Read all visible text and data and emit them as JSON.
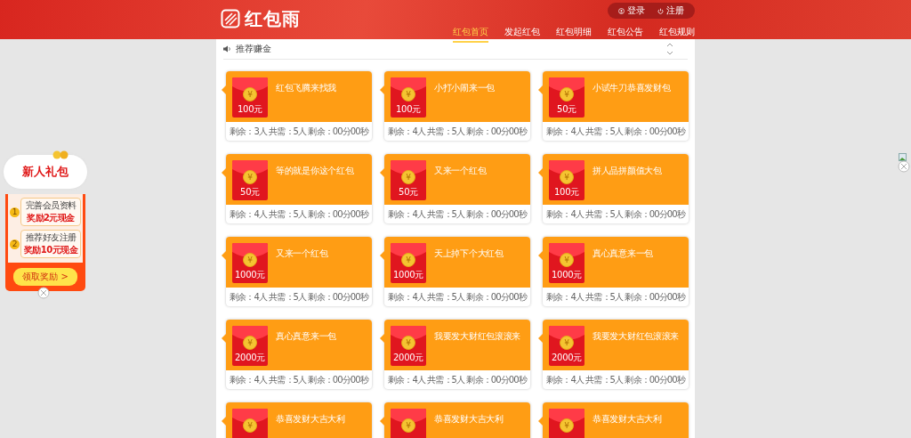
{
  "header": {
    "logo": "红包雨",
    "account_links": [
      {
        "label": "登录",
        "kind": "login"
      },
      {
        "label": "注册",
        "kind": "power"
      }
    ],
    "nav": [
      {
        "label": "红包首页",
        "selected": true
      },
      {
        "label": "发起红包",
        "selected": false
      },
      {
        "label": "红包明细",
        "selected": false
      },
      {
        "label": "红包公告",
        "selected": false
      },
      {
        "label": "红包规则",
        "selected": false
      }
    ]
  },
  "notice": {
    "text": "推荐赚金"
  },
  "cards": [
    {
      "title": "红包飞腾来找我",
      "coin": "¥",
      "amount": "100元",
      "status": "剩余：3人  共需：5人  剩余：00分00秒"
    },
    {
      "title": "小打小闹来一包",
      "coin": "¥",
      "amount": "100元",
      "status": "剩余：4人  共需：5人  剩余：00分00秒"
    },
    {
      "title": "小试牛刀恭喜发财包",
      "coin": "¥",
      "amount": "50元",
      "status": "剩余：4人  共需：5人  剩余：00分00秒"
    },
    {
      "title": "等的就是你这个红包",
      "coin": "¥",
      "amount": "50元",
      "status": "剩余：4人  共需：5人  剩余：00分00秒"
    },
    {
      "title": "又来一个红包",
      "coin": "¥",
      "amount": "50元",
      "status": "剩余：4人  共需：5人  剩余：00分00秒"
    },
    {
      "title": "拼人品拼颜值大包",
      "coin": "¥",
      "amount": "100元",
      "status": "剩余：4人  共需：5人  剩余：00分00秒"
    },
    {
      "title": "又来一个红包",
      "coin": "¥",
      "amount": "1000元",
      "status": "剩余：4人  共需：5人  剩余：00分00秒"
    },
    {
      "title": "天上掉下个大红包",
      "coin": "¥",
      "amount": "1000元",
      "status": "剩余：4人  共需：5人  剩余：00分00秒"
    },
    {
      "title": "真心真意来一包",
      "coin": "¥",
      "amount": "1000元",
      "status": "剩余：4人  共需：5人  剩余：00分00秒"
    },
    {
      "title": "真心真意来一包",
      "coin": "¥",
      "amount": "2000元",
      "status": "剩余：4人  共需：5人  剩余：00分00秒"
    },
    {
      "title": "我要发大财红包滚滚来",
      "coin": "¥",
      "amount": "2000元",
      "status": "剩余：4人  共需：5人  剩余：00分00秒"
    },
    {
      "title": "我要发大财红包滚滚来",
      "coin": "¥",
      "amount": "2000元",
      "status": "剩余：4人  共需：5人  剩余：00分00秒"
    },
    {
      "title": "恭喜发财大吉大利",
      "coin": "¥"
    },
    {
      "title": "恭喜发财大吉大利",
      "coin": "¥"
    },
    {
      "title": "恭喜发财大吉大利",
      "coin": "¥"
    }
  ],
  "side_ad": {
    "title": "新人礼包",
    "steps": [
      {
        "number": "1",
        "line1": "完善会员资料",
        "line2": "奖励2元现金"
      },
      {
        "number": "2",
        "line1": "推荐好友注册",
        "line2": "奖励10元现金"
      }
    ],
    "button": "领取奖励 >"
  }
}
